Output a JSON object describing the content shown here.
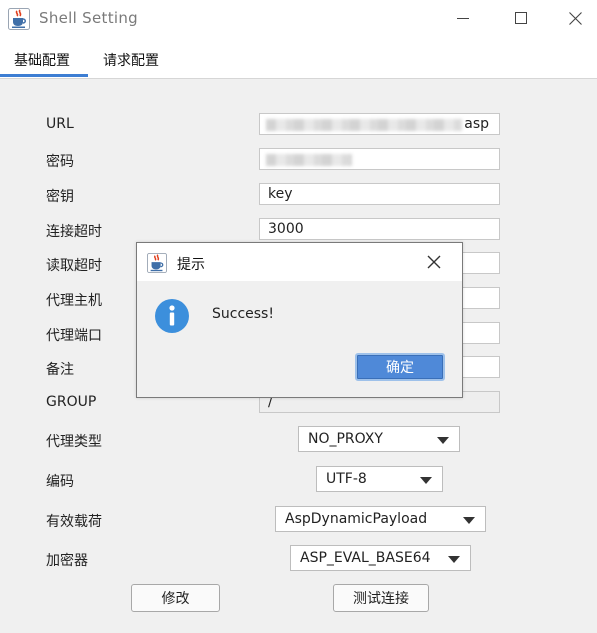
{
  "window": {
    "title": "Shell Setting",
    "icon": "java-coffee-icon",
    "controls": [
      "minimize-icon",
      "maximize-icon",
      "close-icon"
    ]
  },
  "tabs": [
    {
      "label": "基础配置",
      "selected": true
    },
    {
      "label": "请求配置",
      "selected": false
    }
  ],
  "accent_color": "#3d7ed3",
  "form": {
    "url": {
      "label": "URL",
      "value_suffix": "asp"
    },
    "password": {
      "label": "密码"
    },
    "secret_key": {
      "label": "密钥",
      "value": "key"
    },
    "connect_timeout": {
      "label": "连接超时",
      "value": "3000"
    },
    "read_timeout": {
      "label": "读取超时"
    },
    "proxy_host": {
      "label": "代理主机"
    },
    "proxy_port": {
      "label": "代理端口"
    },
    "remark": {
      "label": "备注"
    },
    "group": {
      "label": "GROUP",
      "value": "/"
    },
    "proxy_type": {
      "label": "代理类型",
      "value": "NO_PROXY"
    },
    "encoding": {
      "label": "编码",
      "value": "UTF-8"
    },
    "payload": {
      "label": "有效载荷",
      "value": "AspDynamicPayload"
    },
    "cryption": {
      "label": "加密器",
      "value": "ASP_EVAL_BASE64"
    }
  },
  "buttons": {
    "modify": "修改",
    "test_connection": "测试连接"
  },
  "dialog": {
    "title": "提示",
    "message": "Success!",
    "ok_label": "确定",
    "icon": "info-icon",
    "ok_color": "#4f89d8"
  }
}
